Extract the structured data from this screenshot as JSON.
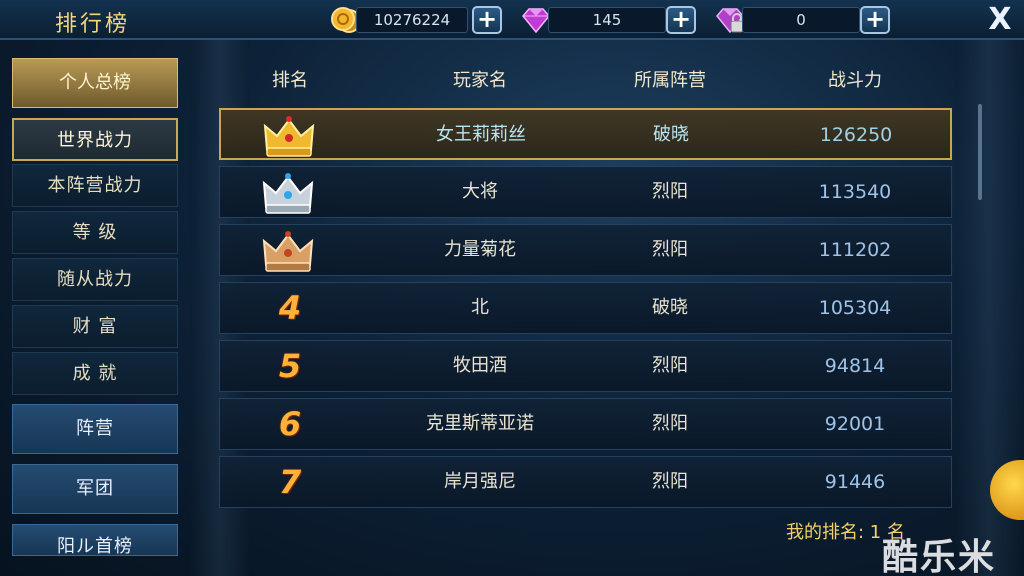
{
  "topbar": {
    "title": "排行榜",
    "gold": "10276224",
    "gems": "145",
    "locked_gems": "0",
    "close": "X"
  },
  "sidebar": {
    "header": "个人总榜",
    "items": [
      {
        "label": "世界战力",
        "active": true
      },
      {
        "label": "本阵营战力"
      },
      {
        "label": "等 级"
      },
      {
        "label": "随从战力"
      },
      {
        "label": "财 富"
      },
      {
        "label": "成 就"
      }
    ],
    "categories": [
      "阵营",
      "军团",
      "阳ル首榜"
    ]
  },
  "table": {
    "headers": [
      "排名",
      "玩家名",
      "所属阵营",
      "战斗力"
    ],
    "rows": [
      {
        "rank": "1",
        "name": "女王莉莉丝",
        "camp": "破晓",
        "power": "126250",
        "icon": "gold-crown-icon",
        "me": true
      },
      {
        "rank": "2",
        "name": "大将",
        "camp": "烈阳",
        "power": "113540",
        "icon": "silver-crown-icon"
      },
      {
        "rank": "3",
        "name": "力量菊花",
        "camp": "烈阳",
        "power": "111202",
        "icon": "bronze-crown-icon"
      },
      {
        "rank": "4",
        "name": "北",
        "camp": "破晓",
        "power": "105304"
      },
      {
        "rank": "5",
        "name": "牧田酒",
        "camp": "烈阳",
        "power": "94814"
      },
      {
        "rank": "6",
        "name": "克里斯蒂亚诺",
        "camp": "烈阳",
        "power": "92001"
      },
      {
        "rank": "7",
        "name": "岸月强尼",
        "camp": "烈阳",
        "power": "91446"
      }
    ]
  },
  "my_rank": "我的排名: 1 名",
  "watermark": "酷乐米",
  "colors": {
    "accent_gold": "#f3d67a",
    "power_blue": "#9fc3e6",
    "rank_orange": "#ffb13a"
  }
}
